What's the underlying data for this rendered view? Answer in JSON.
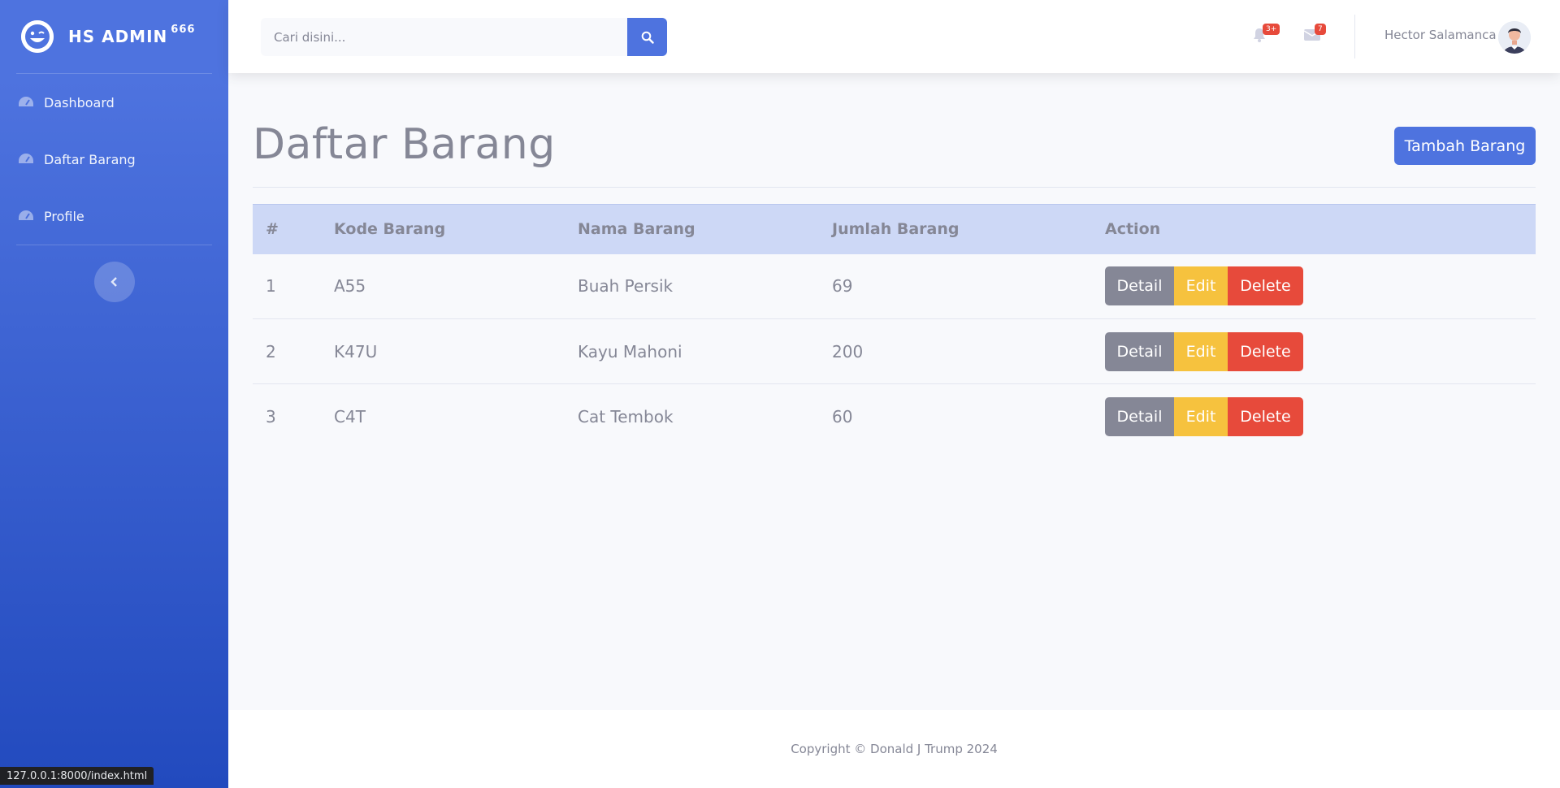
{
  "brand": {
    "name": "HS ADMIN",
    "sup": "666"
  },
  "sidebar": {
    "items": [
      {
        "label": "Dashboard",
        "icon": "tachometer-icon"
      },
      {
        "label": "Daftar Barang",
        "icon": "tachometer-icon"
      },
      {
        "label": "Profile",
        "icon": "tachometer-icon"
      }
    ]
  },
  "topbar": {
    "search_placeholder": "Cari disini...",
    "alerts_count": "3+",
    "messages_count": "7",
    "user_name": "Hector Salamanca"
  },
  "page": {
    "title": "Daftar Barang",
    "add_button": "Tambah Barang"
  },
  "table": {
    "headers": [
      "#",
      "Kode Barang",
      "Nama Barang",
      "Jumlah Barang",
      "Action"
    ],
    "rows": [
      {
        "no": "1",
        "kode": "A55",
        "nama": "Buah Persik",
        "jumlah": "69"
      },
      {
        "no": "2",
        "kode": "K47U",
        "nama": "Kayu Mahoni",
        "jumlah": "200"
      },
      {
        "no": "3",
        "kode": "C4T",
        "nama": "Cat Tembok",
        "jumlah": "60"
      }
    ],
    "actions": {
      "detail": "Detail",
      "edit": "Edit",
      "delete": "Delete"
    }
  },
  "footer": {
    "copyright": "Copyright © Donald J Trump 2024"
  },
  "status_bar": {
    "url": "127.0.0.1:8000/index.html"
  },
  "colors": {
    "primary": "#4e73df",
    "primary_dark": "#224abe",
    "secondary": "#858796",
    "warning": "#f6c23e",
    "danger": "#e74a3b",
    "table_header": "#cdd8f6"
  }
}
